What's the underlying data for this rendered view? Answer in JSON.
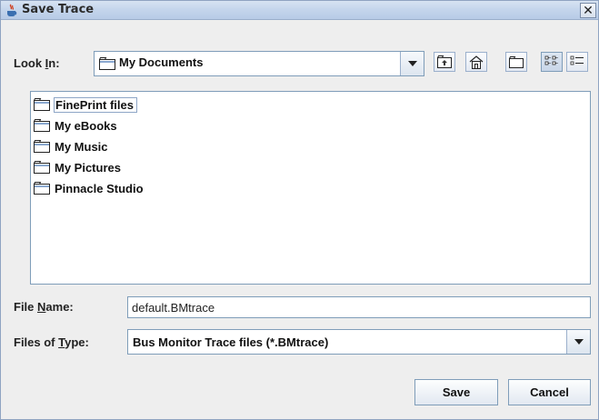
{
  "window": {
    "title": "Save Trace",
    "close_glyph": "✕"
  },
  "look_in": {
    "label_pre": "Look ",
    "label_mnemonic": "I",
    "label_post": "n:",
    "value": "My Documents"
  },
  "toolbar": {
    "buttons": [
      {
        "name": "up-one-level-icon"
      },
      {
        "name": "home-icon"
      },
      {
        "name": "new-folder-icon"
      },
      {
        "name": "list-view-icon"
      },
      {
        "name": "details-view-icon"
      }
    ]
  },
  "files": [
    {
      "name": "FinePrint files",
      "selected": true
    },
    {
      "name": "My eBooks",
      "selected": false
    },
    {
      "name": "My Music",
      "selected": false
    },
    {
      "name": "My Pictures",
      "selected": false
    },
    {
      "name": "Pinnacle Studio",
      "selected": false
    }
  ],
  "file_name": {
    "label_pre": "File ",
    "label_mnemonic": "N",
    "label_post": "ame:",
    "value": "default.BMtrace"
  },
  "file_type": {
    "label_pre": "Files of ",
    "label_mnemonic": "T",
    "label_post": "ype:",
    "value": "Bus Monitor Trace files (*.BMtrace)"
  },
  "buttons": {
    "save": "Save",
    "cancel": "Cancel"
  },
  "colors": {
    "accent": "#7f9db9",
    "dialog_bg": "#eeeeee"
  }
}
